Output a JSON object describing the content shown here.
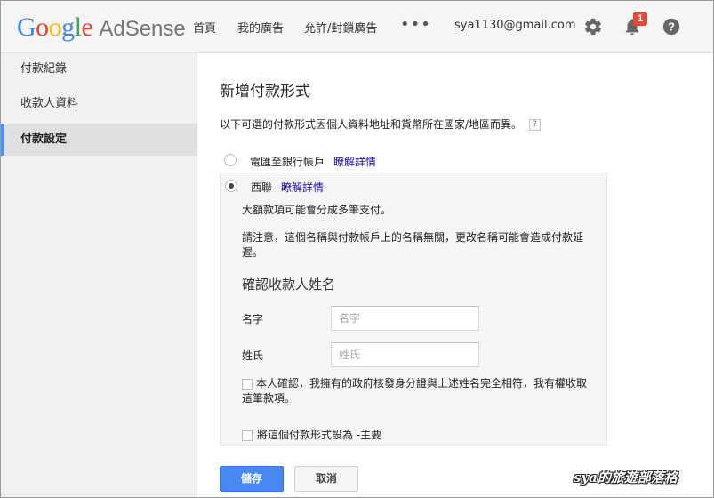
{
  "header": {
    "logo_google": [
      "G",
      "o",
      "o",
      "g",
      "l",
      "e"
    ],
    "logo_colors": [
      "#4285f4",
      "#ea4335",
      "#fbbc05",
      "#4285f4",
      "#34a853",
      "#ea4335"
    ],
    "logo_product": "AdSense",
    "nav": [
      "首頁",
      "我的廣告",
      "允許/封鎖廣告"
    ],
    "more": "•••",
    "account": "sya1130@gmail.com",
    "notification_count": "1",
    "icons": [
      "gear-icon",
      "bell-icon",
      "help-icon"
    ]
  },
  "sidebar": {
    "items": [
      {
        "label": "付款紀錄",
        "active": false
      },
      {
        "label": "收款人資料",
        "active": false
      },
      {
        "label": "付款設定",
        "active": true
      }
    ]
  },
  "main": {
    "title": "新增付款形式",
    "intro": "以下可選的付款形式因個人資料地址和貨幣所在國家/地區而異。",
    "help": "?",
    "options": [
      {
        "label": "電匯至銀行帳戶",
        "link": "瞭解詳情",
        "selected": false
      },
      {
        "label": "西聯",
        "link": "瞭解詳情",
        "selected": true
      }
    ],
    "panel": {
      "note1": "大額款項可能會分成多筆支付。",
      "note2": "請注意，這個名稱與付款帳戶上的名稱無關，更改名稱可能會造成付款延遲。",
      "section_title": "確認收款人姓名",
      "first_name_label": "名字",
      "first_name_placeholder": "名字",
      "last_name_label": "姓氏",
      "last_name_placeholder": "姓氏",
      "confirm_text": "本人確認，我擁有的政府核發身分證與上述姓名完全相符，我有權收取這筆款項。",
      "primary_text": "將這個付款形式設為 -主要"
    },
    "save_label": "儲存",
    "cancel_label": "取消"
  },
  "watermark": "sya的旅遊部落格",
  "colors": {
    "accent": "#4d90fe",
    "primary_button": "#4889f1",
    "link": "#1a0dab"
  }
}
